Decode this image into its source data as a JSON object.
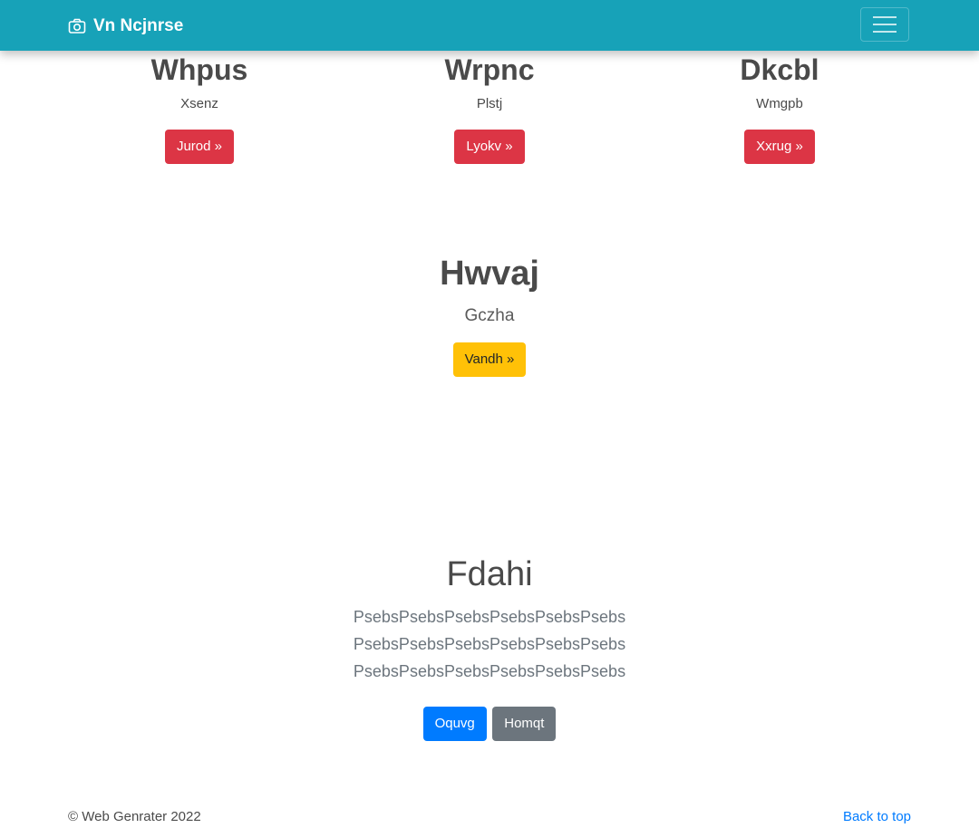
{
  "navbar": {
    "brand": "Vn Ncjnrse",
    "brand_icon": "camera-icon",
    "toggler_icon": "hamburger-icon"
  },
  "columns": [
    {
      "title": "Whpus",
      "text": "Xsenz",
      "button": "Jurod »"
    },
    {
      "title": "Wrpnc",
      "text": "Plstj",
      "button": "Lyokv »"
    },
    {
      "title": "Dkcbl",
      "text": "Wmgpb",
      "button": "Xxrug »"
    }
  ],
  "feature": {
    "title": "Hwvaj",
    "text": "Gczha",
    "button": "Vandh »"
  },
  "jumbotron": {
    "title": "Fdahi",
    "text": "PsebsPsebsPsebsPsebsPsebsPsebs PsebsPsebsPsebsPsebsPsebsPsebs PsebsPsebsPsebsPsebsPsebsPsebs",
    "primary_button": "Oquvg",
    "secondary_button": "Homqt"
  },
  "footer": {
    "copyright": "© Web Genrater 2022",
    "back_to_top": "Back to top"
  },
  "colors": {
    "navbar": "#17a2b8",
    "danger": "#dc3545",
    "warning": "#ffc107",
    "primary": "#007bff",
    "secondary": "#6c757d"
  }
}
